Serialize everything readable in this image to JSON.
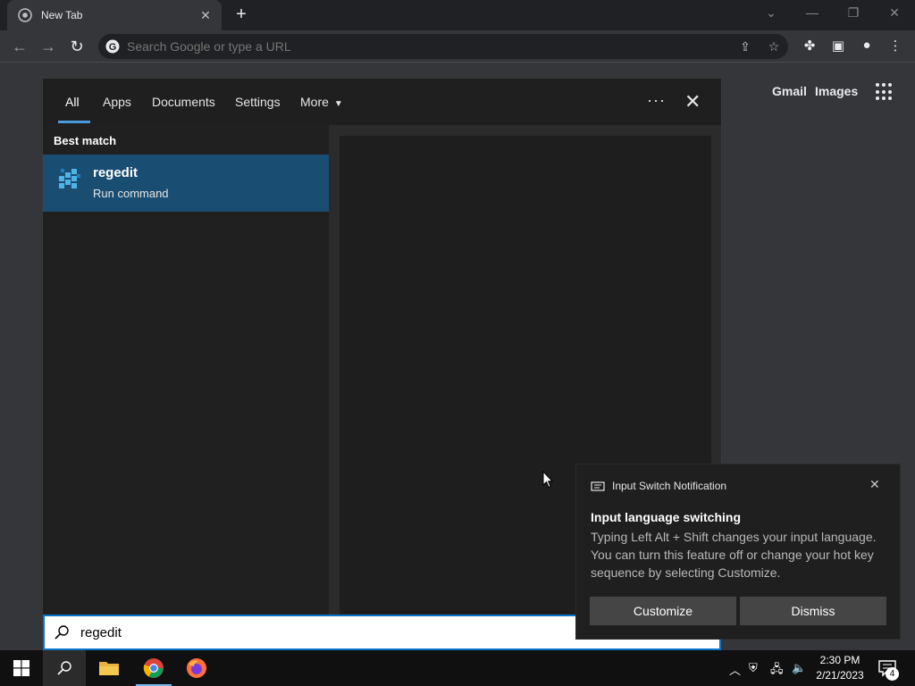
{
  "browser": {
    "tab_title": "New Tab",
    "omnibox_placeholder": "Search Google or type a URL",
    "ntp_links": [
      "Gmail",
      "Images"
    ]
  },
  "search_panel": {
    "tabs": [
      "All",
      "Apps",
      "Documents",
      "Settings",
      "More"
    ],
    "active_tab": "All",
    "section_label": "Best match",
    "best_match": {
      "title": "regedit",
      "subtitle": "Run command"
    },
    "query": "regedit"
  },
  "toast": {
    "app_name": "Input Switch Notification",
    "title": "Input language switching",
    "body": "Typing Left Alt + Shift changes your input language. You can turn this feature off or change your hot key sequence by selecting Customize.",
    "buttons": {
      "customize": "Customize",
      "dismiss": "Dismiss"
    }
  },
  "taskbar": {
    "time": "2:30 PM",
    "date": "2/21/2023",
    "notification_count": "4"
  },
  "colors": {
    "accent": "#0a74c9",
    "selection": "#1a4d72",
    "tab_underline": "#4a9bdc"
  }
}
